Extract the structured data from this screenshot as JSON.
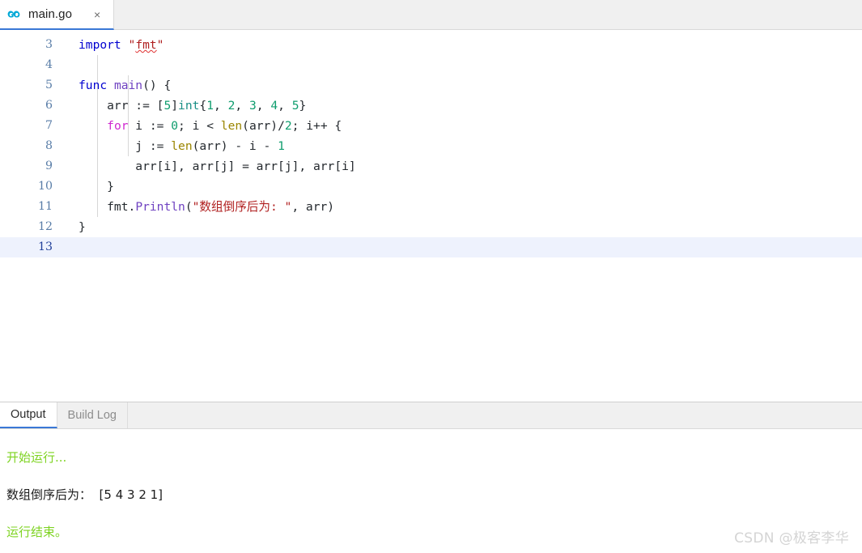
{
  "window": {
    "accent_color": "#3a78d6",
    "background": "#ffffff"
  },
  "editor_tabs": [
    {
      "label": "main.go",
      "icon": "go-language-icon",
      "active": true,
      "close_icon": "×"
    }
  ],
  "editor": {
    "language": "go",
    "active_line": 13,
    "first_visible_line": 3,
    "lines": [
      {
        "n": "3",
        "tokens": [
          {
            "t": "import",
            "c": "t-kw"
          },
          {
            "t": " ",
            "c": "t-plain"
          },
          {
            "t": "\"",
            "c": "t-str"
          },
          {
            "t": "fmt",
            "c": "t-str squig"
          },
          {
            "t": "\"",
            "c": "t-str"
          }
        ]
      },
      {
        "n": "4",
        "tokens": []
      },
      {
        "n": "5",
        "tokens": [
          {
            "t": "func",
            "c": "t-kw"
          },
          {
            "t": " ",
            "c": "t-plain"
          },
          {
            "t": "main",
            "c": "t-fn"
          },
          {
            "t": "() {",
            "c": "t-punct"
          }
        ]
      },
      {
        "n": "6",
        "tokens": [
          {
            "t": "    arr ",
            "c": "t-plain"
          },
          {
            "t": ":=",
            "c": "t-punct"
          },
          {
            "t": " [",
            "c": "t-punct"
          },
          {
            "t": "5",
            "c": "t-num"
          },
          {
            "t": "]",
            "c": "t-punct"
          },
          {
            "t": "int",
            "c": "t-type"
          },
          {
            "t": "{",
            "c": "t-punct"
          },
          {
            "t": "1",
            "c": "t-num"
          },
          {
            "t": ", ",
            "c": "t-punct"
          },
          {
            "t": "2",
            "c": "t-num"
          },
          {
            "t": ", ",
            "c": "t-punct"
          },
          {
            "t": "3",
            "c": "t-num"
          },
          {
            "t": ", ",
            "c": "t-punct"
          },
          {
            "t": "4",
            "c": "t-num"
          },
          {
            "t": ", ",
            "c": "t-punct"
          },
          {
            "t": "5",
            "c": "t-num"
          },
          {
            "t": "}",
            "c": "t-punct"
          }
        ]
      },
      {
        "n": "7",
        "tokens": [
          {
            "t": "    ",
            "c": "t-plain"
          },
          {
            "t": "for",
            "c": "t-kw2"
          },
          {
            "t": " i ",
            "c": "t-plain"
          },
          {
            "t": ":=",
            "c": "t-punct"
          },
          {
            "t": " ",
            "c": "t-plain"
          },
          {
            "t": "0",
            "c": "t-num"
          },
          {
            "t": "; i ",
            "c": "t-punct"
          },
          {
            "t": "<",
            "c": "t-punct"
          },
          {
            "t": " ",
            "c": "t-plain"
          },
          {
            "t": "len",
            "c": "t-builtin"
          },
          {
            "t": "(arr)/",
            "c": "t-punct"
          },
          {
            "t": "2",
            "c": "t-num"
          },
          {
            "t": "; i++ {",
            "c": "t-punct"
          }
        ]
      },
      {
        "n": "8",
        "tokens": [
          {
            "t": "        j ",
            "c": "t-plain"
          },
          {
            "t": ":=",
            "c": "t-punct"
          },
          {
            "t": " ",
            "c": "t-plain"
          },
          {
            "t": "len",
            "c": "t-builtin"
          },
          {
            "t": "(arr) ",
            "c": "t-punct"
          },
          {
            "t": "-",
            "c": "t-punct"
          },
          {
            "t": " i ",
            "c": "t-plain"
          },
          {
            "t": "-",
            "c": "t-punct"
          },
          {
            "t": " ",
            "c": "t-plain"
          },
          {
            "t": "1",
            "c": "t-num"
          }
        ]
      },
      {
        "n": "9",
        "tokens": [
          {
            "t": "        arr[i], arr[j] ",
            "c": "t-plain"
          },
          {
            "t": "=",
            "c": "t-punct"
          },
          {
            "t": " arr[j], arr[i]",
            "c": "t-plain"
          }
        ]
      },
      {
        "n": "10",
        "tokens": [
          {
            "t": "    }",
            "c": "t-punct"
          }
        ]
      },
      {
        "n": "11",
        "tokens": [
          {
            "t": "    fmt",
            "c": "t-plain"
          },
          {
            "t": ".",
            "c": "t-punct"
          },
          {
            "t": "Println",
            "c": "t-fn"
          },
          {
            "t": "(",
            "c": "t-punct"
          },
          {
            "t": "\"数组倒序后为: \"",
            "c": "t-str"
          },
          {
            "t": ", arr)",
            "c": "t-punct"
          }
        ]
      },
      {
        "n": "12",
        "tokens": [
          {
            "t": "}",
            "c": "t-punct"
          }
        ]
      },
      {
        "n": "13",
        "tokens": [],
        "active": true
      }
    ]
  },
  "panel": {
    "tabs": [
      {
        "label": "Output",
        "active": true
      },
      {
        "label": "Build Log",
        "active": false
      }
    ],
    "output_lines": [
      {
        "text": "开始运行...",
        "color": "green"
      },
      {
        "text": "数组倒序后为：  [5 4 3 2 1]",
        "color": "black"
      },
      {
        "text": "运行结束。",
        "color": "green"
      }
    ]
  },
  "watermark": {
    "text": "CSDN @极客李华"
  }
}
